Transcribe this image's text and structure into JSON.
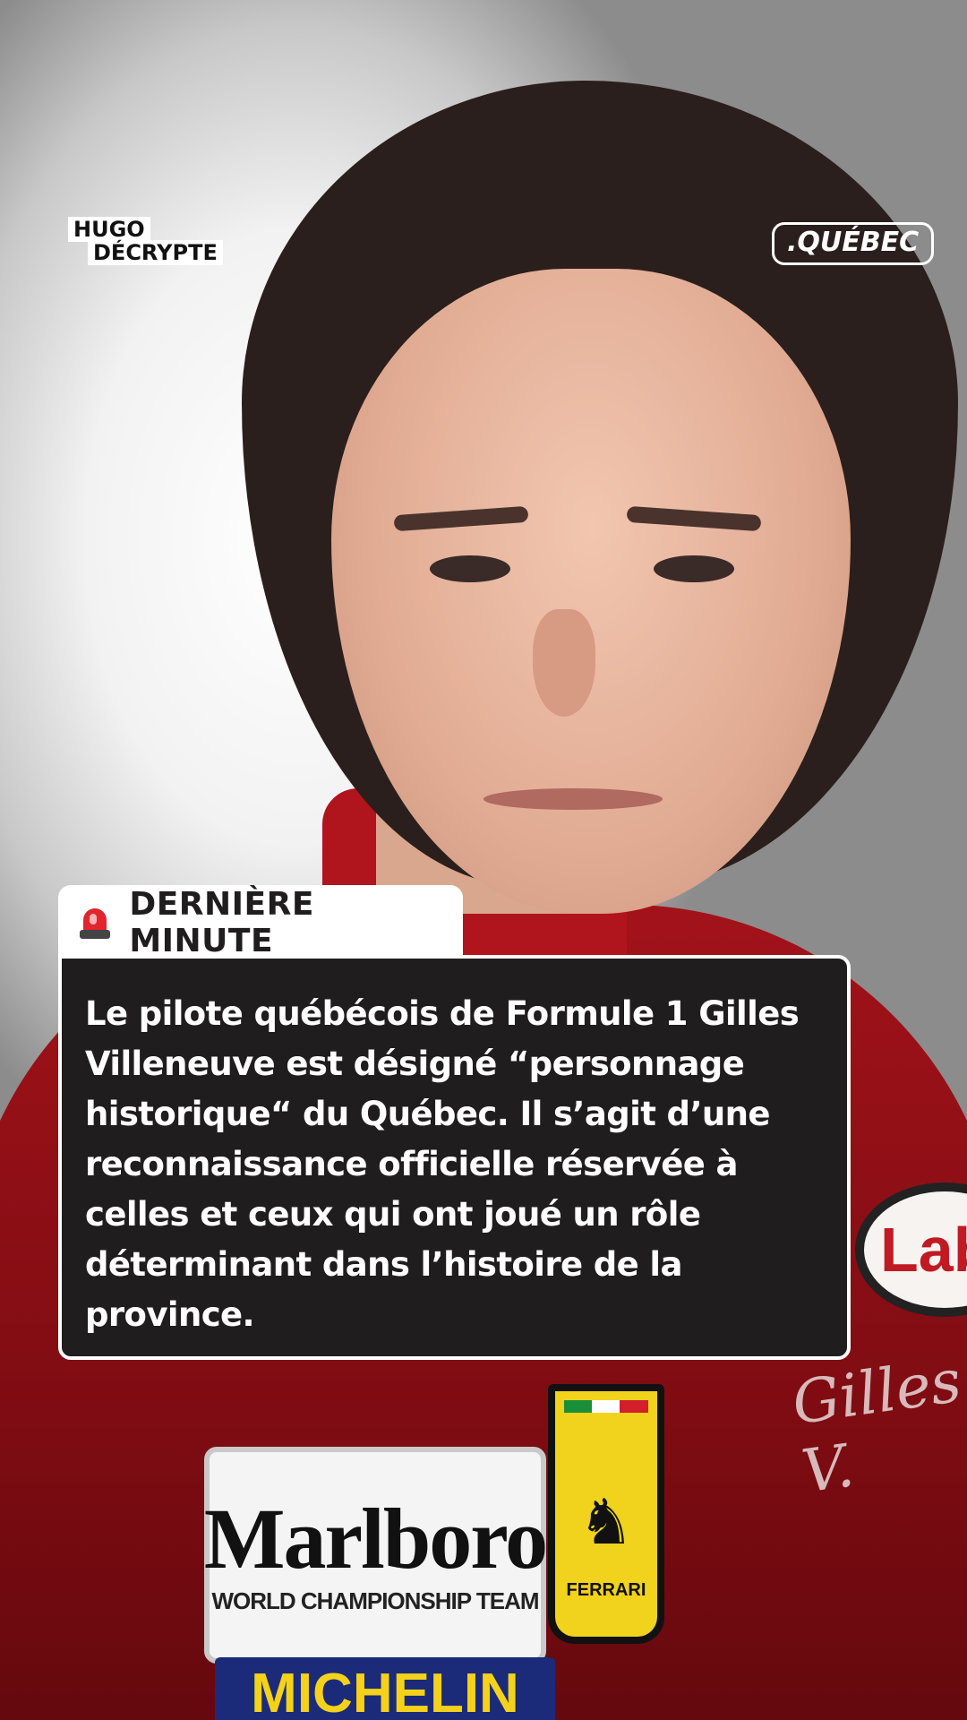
{
  "brand": {
    "hugo_line1": "HUGO",
    "hugo_line2": "DÉCRYPTE",
    "region_badge": ".QUÉBEC"
  },
  "photo": {
    "patch_marlboro": "Marlboro",
    "patch_marlboro_sub": "WORLD CHAMPIONSHIP TEAM",
    "patch_michelin": "MICHELIN",
    "patch_ferrari": "FERRARI",
    "patch_lab": "Lab",
    "signature": "Gilles V."
  },
  "breaking": {
    "icon": "siren-icon",
    "label": "DERNIÈRE MINUTE",
    "text": "Le pilote québécois de Formule 1 Gilles Villeneuve est désigné “personnage historique“ du Québec. Il s’agit d’une reconnaissance officielle réservée à celles et ceux qui ont joué un rôle déterminant dans l’histoire de la province."
  },
  "colors": {
    "card_bg": "#1f1d1e",
    "siren_red": "#e0252e",
    "suit_red": "#a3121a"
  }
}
